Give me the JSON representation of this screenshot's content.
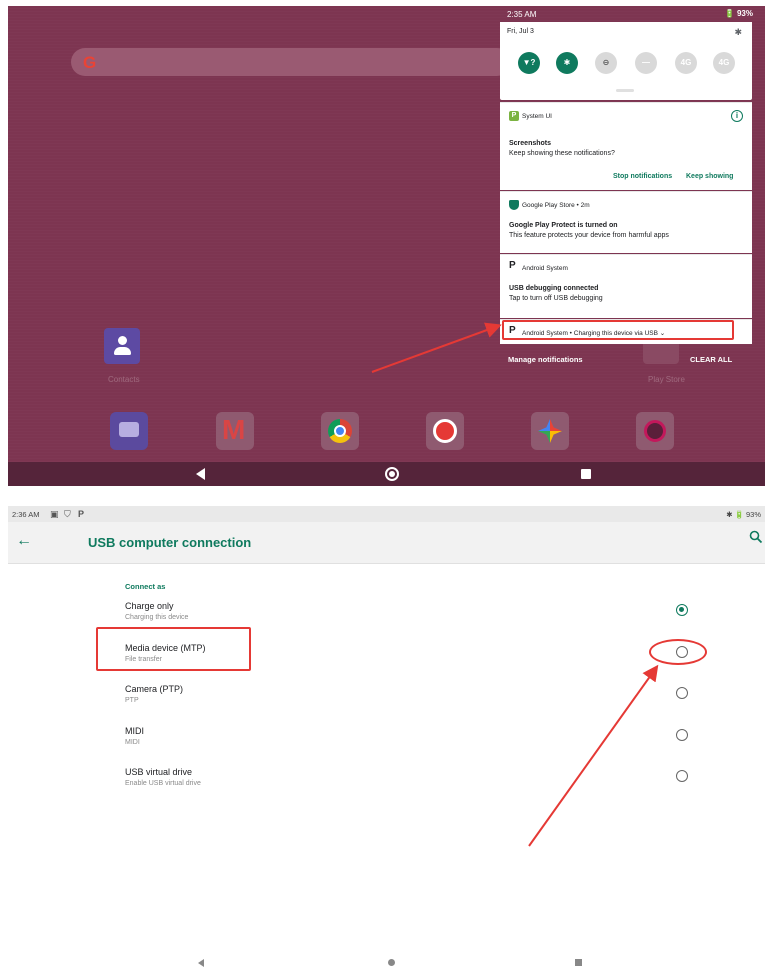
{
  "top": {
    "status": {
      "time": "2:35 AM",
      "battery": "🔋 93%"
    },
    "search": {
      "logo": "G"
    },
    "home": {
      "contacts_label": "Contacts",
      "playstore_label": "Play Store"
    },
    "quick_settings": {
      "date": "Fri, Jul 3",
      "bt_small": "✱",
      "tiles": [
        {
          "name": "wifi",
          "glyph": "▼?",
          "on": true
        },
        {
          "name": "bluetooth",
          "glyph": "✱",
          "on": true
        },
        {
          "name": "dnd",
          "glyph": "⊖",
          "on": false
        },
        {
          "name": "flashlight",
          "glyph": "—",
          "on": false
        },
        {
          "name": "4g-sim1",
          "glyph": "4G",
          "on": false
        },
        {
          "name": "4g-sim2",
          "glyph": "4G",
          "on": false
        }
      ]
    },
    "notifications": {
      "systemui": {
        "app": "System UI",
        "app_glyph": "P",
        "title": "Screenshots",
        "text": "Keep showing these notifications?",
        "action_stop": "Stop notifications",
        "action_keep": "Keep showing"
      },
      "playstore": {
        "app": "Google Play Store • 2m",
        "title": "Google Play Protect is turned on",
        "text": "This feature protects your device from harmful apps"
      },
      "android": {
        "app": "Android System",
        "app_glyph": "P",
        "title": "USB debugging connected",
        "text": "Tap to turn off USB debugging"
      },
      "charging": {
        "app": "Android System • Charging this device via USB ⌄",
        "app_glyph": "P"
      }
    },
    "manage": "Manage notifications",
    "clear_all": "CLEAR ALL"
  },
  "bottom": {
    "status": {
      "time": "2:36 AM",
      "battery": "✱ 🔋 93%"
    },
    "title": "USB computer connection",
    "section": "Connect as",
    "options": [
      {
        "label": "Charge only",
        "sub": "Charging this device",
        "checked": true
      },
      {
        "label": "Media device (MTP)",
        "sub": "File transfer",
        "checked": false
      },
      {
        "label": "Camera (PTP)",
        "sub": "PTP",
        "checked": false
      },
      {
        "label": "MIDI",
        "sub": "MIDI",
        "checked": false
      },
      {
        "label": "USB virtual drive",
        "sub": "Enable USB virtual drive",
        "checked": false
      }
    ]
  },
  "colors": {
    "accent": "#0f7a5e",
    "wallpaper": "#7d3551",
    "annotation": "#e53935"
  }
}
